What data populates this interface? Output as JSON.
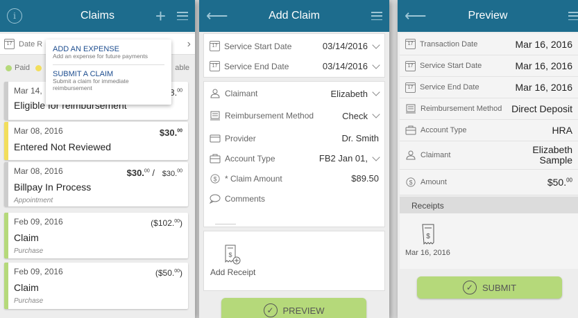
{
  "claims": {
    "title": "Claims",
    "filter_label": "Date R",
    "legend_paid": "Paid",
    "legend_cut": "able",
    "colors": {
      "header": "#1d6c8d",
      "paid": "#b5d97a",
      "entered": "#f2de5c",
      "pending": "#cccccc"
    },
    "menu": {
      "add_title": "ADD AN EXPENSE",
      "add_desc": "Add an expense for future payments",
      "submit_title": "SUBMIT A CLAIM",
      "submit_desc": "Submit a claim for immediate reimbursement"
    },
    "cards": [
      {
        "date": "Mar 14,",
        "amount": "48.",
        "amount_sup": "00",
        "status": "Eligible for reimbursement",
        "sub": ""
      },
      {
        "date": "Mar 08, 2016",
        "amount": "$30.",
        "amount_sup": "00",
        "status": "Entered Not Reviewed",
        "sub": ""
      },
      {
        "date": "Mar 08, 2016",
        "amount": "$30.",
        "amount_sup": "00",
        "amount2": "$30.",
        "amount2_sup": "00",
        "status": "Billpay In Process",
        "sub": "Appointment"
      },
      {
        "date": "Feb 09, 2016",
        "amount": "($102.",
        "amount_sup": "00",
        "amount_close": ")",
        "status": "Claim",
        "sub": "Purchase"
      },
      {
        "date": "Feb 09, 2016",
        "amount": "($50.",
        "amount_sup": "00",
        "amount_close": ")",
        "status": "Claim",
        "sub": "Purchase"
      }
    ]
  },
  "add_claim": {
    "title": "Add Claim",
    "service_start_label": "Service Start Date",
    "service_start_value": "03/14/2016",
    "service_end_label": "Service End Date",
    "service_end_value": "03/14/2016",
    "claimant_label": "Claimant",
    "claimant_value": "Elizabeth",
    "reimb_label": "Reimbursement Method",
    "reimb_value": "Check",
    "provider_label": "Provider",
    "provider_value": "Dr. Smith",
    "account_label": "Account Type",
    "account_value": "FB2 Jan 01,",
    "amount_label": "* Claim Amount",
    "amount_value": "$89.50",
    "comments_label": "Comments",
    "add_receipt": "Add Receipt",
    "preview_button": "PREVIEW"
  },
  "preview": {
    "title": "Preview",
    "rows": [
      {
        "icon": "calendar-icon",
        "label": "Transaction Date",
        "value": "Mar 16, 2016"
      },
      {
        "icon": "calendar-icon",
        "label": "Service Start Date",
        "value": "Mar 16, 2016"
      },
      {
        "icon": "calendar-icon",
        "label": "Service End Date",
        "value": "Mar 16, 2016"
      },
      {
        "icon": "reimbursement-icon",
        "label": "Reimbursement Method",
        "value": "Direct Deposit"
      },
      {
        "icon": "briefcase-icon",
        "label": "Account Type",
        "value": "HRA"
      },
      {
        "icon": "person-icon",
        "label": "Claimant",
        "value": "Elizabeth Sample"
      },
      {
        "icon": "dollar-icon",
        "label": "Amount",
        "value": "$50.",
        "value_sup": "00"
      }
    ],
    "receipts_label": "Receipts",
    "receipt_date": "Mar 16, 2016",
    "submit_button": "SUBMIT"
  }
}
